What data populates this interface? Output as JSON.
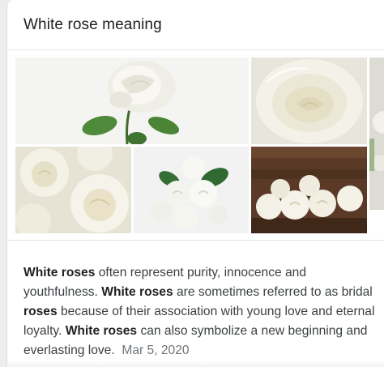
{
  "card": {
    "title": "White rose meaning"
  },
  "images": [
    {
      "name": "image-single-rose-stem",
      "alt": ""
    },
    {
      "name": "image-rose-closeup",
      "alt": ""
    },
    {
      "name": "image-rose-pile",
      "alt": ""
    },
    {
      "name": "image-rose-bouquet",
      "alt": ""
    },
    {
      "name": "image-roses-wood-background",
      "alt": ""
    }
  ],
  "snippet": {
    "s1": "White roses",
    "s2": " often represent purity, innocence and youthfulness. ",
    "s3": "White roses",
    "s4": " are sometimes referred to as bridal ",
    "s5": "roses",
    "s6": " because of their association with young love and eternal loyalty. ",
    "s7": "White roses",
    "s8": " can also symbolize a new beginning and everlasting love.",
    "date": "Mar 5, 2020"
  },
  "colors": {
    "title": "#202124",
    "body_text": "#3c4043",
    "date": "#70757a",
    "divider": "#e4e4e4"
  }
}
